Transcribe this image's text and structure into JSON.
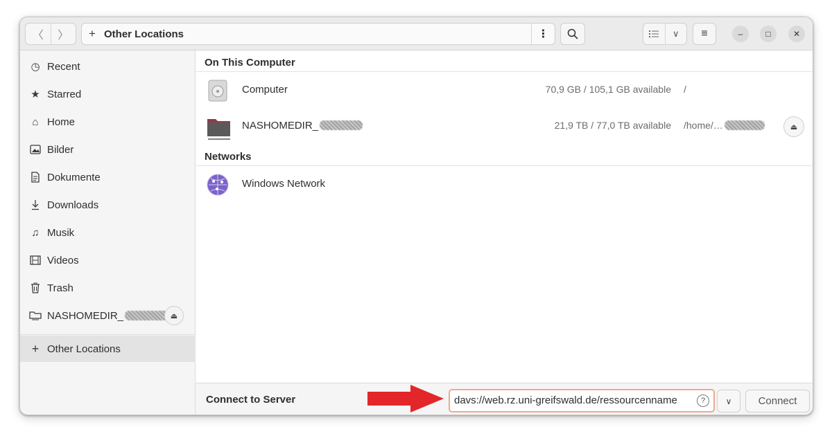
{
  "header": {
    "back_icon": "chevron-left-icon",
    "forward_icon": "chevron-right-icon",
    "path_label": "Other Locations",
    "path_icon": "plus-icon"
  },
  "sidebar": {
    "items": [
      {
        "label": "Recent",
        "icon": "clock-icon"
      },
      {
        "label": "Starred",
        "icon": "star-icon"
      },
      {
        "label": "Home",
        "icon": "home-icon"
      },
      {
        "label": "Bilder",
        "icon": "image-icon"
      },
      {
        "label": "Dokumente",
        "icon": "document-icon"
      },
      {
        "label": "Downloads",
        "icon": "download-icon"
      },
      {
        "label": "Musik",
        "icon": "music-icon"
      },
      {
        "label": "Videos",
        "icon": "video-icon"
      },
      {
        "label": "Trash",
        "icon": "trash-icon"
      },
      {
        "label": "NASHOMEDIR_",
        "icon": "network-drive-icon"
      }
    ],
    "other_locations": "Other Locations"
  },
  "main": {
    "on_this_computer": "On This Computer",
    "networks": "Networks",
    "computer": {
      "name": "Computer",
      "space": "70,9 GB / 105,1 GB available",
      "path": "/"
    },
    "nas": {
      "name": "NASHOMEDIR_",
      "space": "21,9 TB / 77,0 TB available",
      "path": "/home/…"
    },
    "windows_network": {
      "name": "Windows Network"
    }
  },
  "bottom": {
    "connect_to_server": "Connect to Server",
    "server_address": "davs://web.rz.uni-greifswald.de/ressourcenname",
    "connect_button": "Connect"
  },
  "colors": {
    "annotation_arrow": "#e3262a",
    "input_focus_border": "#f0a890"
  }
}
